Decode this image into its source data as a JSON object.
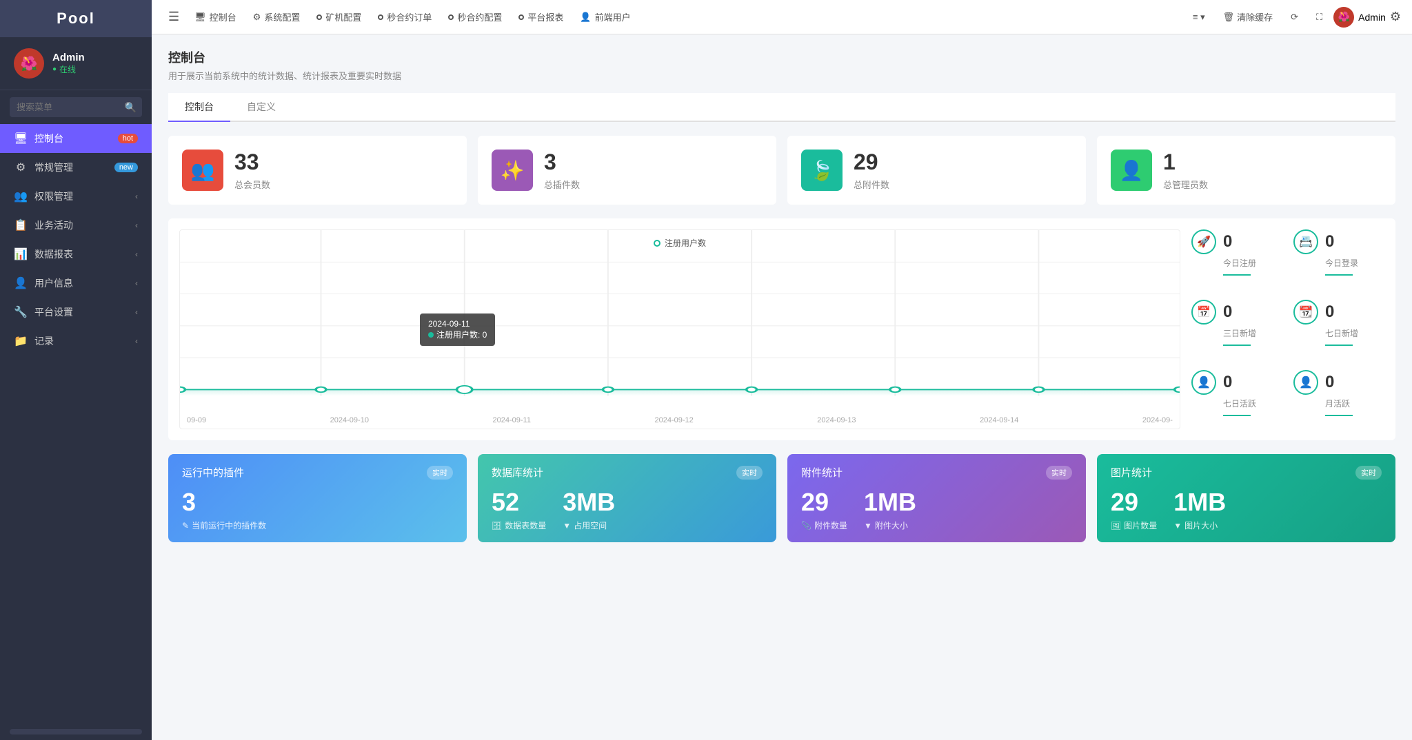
{
  "sidebar": {
    "logo": "Pool",
    "user": {
      "name": "Admin",
      "status": "在线",
      "avatar": "🌺"
    },
    "search_placeholder": "搜索菜单",
    "nav": [
      {
        "id": "dashboard",
        "icon": "🖥",
        "label": "控制台",
        "badge": "hot",
        "badge_type": "hot",
        "active": true
      },
      {
        "id": "general",
        "icon": "⚙",
        "label": "常规管理",
        "badge": "new",
        "badge_type": "new",
        "active": false
      },
      {
        "id": "permission",
        "icon": "👥",
        "label": "权限管理",
        "chevron": true,
        "active": false
      },
      {
        "id": "business",
        "icon": "📋",
        "label": "业务活动",
        "chevron": true,
        "active": false
      },
      {
        "id": "data",
        "icon": "📊",
        "label": "数据报表",
        "chevron": true,
        "active": false
      },
      {
        "id": "userinfo",
        "icon": "👤",
        "label": "用户信息",
        "chevron": true,
        "active": false
      },
      {
        "id": "platform",
        "icon": "🔧",
        "label": "平台设置",
        "chevron": true,
        "active": false
      },
      {
        "id": "record",
        "icon": "📁",
        "label": "记录",
        "chevron": true,
        "active": false
      }
    ]
  },
  "topnav": {
    "items": [
      {
        "icon": "🖥",
        "label": "控制台",
        "dot": false
      },
      {
        "icon": "⚙",
        "label": "系统配置",
        "dot": false
      },
      {
        "icon": "",
        "label": "矿机配置",
        "dot": true
      },
      {
        "icon": "",
        "label": "秒合约订单",
        "dot": true
      },
      {
        "icon": "",
        "label": "秒合约配置",
        "dot": true
      },
      {
        "icon": "",
        "label": "平台报表",
        "dot": true
      },
      {
        "icon": "",
        "label": "前端用户",
        "dot": true
      }
    ],
    "more_label": "≡",
    "clear_label": "清除缓存",
    "admin_label": "Admin",
    "admin_avatar": "🌺"
  },
  "page": {
    "title": "控制台",
    "description": "用于展示当前系统中的统计数据、统计报表及重要实时数据",
    "tabs": [
      {
        "id": "dashboard",
        "label": "控制台",
        "active": true
      },
      {
        "id": "custom",
        "label": "自定义",
        "active": false
      }
    ]
  },
  "stats": [
    {
      "id": "members",
      "icon": "👥",
      "icon_class": "stat-icon-red",
      "num": "33",
      "label": "总会员数"
    },
    {
      "id": "plugins",
      "icon": "✨",
      "icon_class": "stat-icon-purple",
      "num": "3",
      "label": "总插件数"
    },
    {
      "id": "attachments",
      "icon": "🍃",
      "icon_class": "stat-icon-teal",
      "num": "29",
      "label": "总附件数"
    },
    {
      "id": "admins",
      "icon": "👤",
      "icon_class": "stat-icon-green",
      "num": "1",
      "label": "总管理员数"
    }
  ],
  "chart": {
    "title": "注册用户数",
    "tooltip_date": "2024-09-11",
    "tooltip_label": "注册用户数: 0",
    "xaxis": [
      "09-09",
      "2024-09-10",
      "2024-09-11",
      "2024-09-12",
      "2024-09-13",
      "2024-09-14",
      "2024-09-"
    ]
  },
  "side_stats": [
    {
      "id": "today_reg",
      "icon": "🚀",
      "num": "0",
      "label": "今日注册"
    },
    {
      "id": "today_login",
      "icon": "📇",
      "num": "0",
      "label": "今日登录"
    },
    {
      "id": "three_day",
      "icon": "📅",
      "num": "0",
      "label": "三日新增"
    },
    {
      "id": "seven_day_new",
      "icon": "📆",
      "num": "0",
      "label": "七日新增"
    },
    {
      "id": "seven_day_active",
      "icon": "👤",
      "num": "0",
      "label": "七日活跃"
    },
    {
      "id": "month_active",
      "icon": "👤",
      "num": "0",
      "label": "月活跃"
    }
  ],
  "bottom_cards": [
    {
      "id": "plugins_running",
      "title": "运行中的插件",
      "badge": "实时",
      "color_class": "bottom-card-blue",
      "num1": "3",
      "num2": null,
      "label1": "当前运行中的插件数",
      "label1_icon": "✎",
      "label2": null
    },
    {
      "id": "db_stats",
      "title": "数据库统计",
      "badge": "实时",
      "color_class": "bottom-card-teal",
      "num1": "52",
      "num2": "3MB",
      "label1": "数据表数量",
      "label1_icon": "🗄",
      "label2": "占用空间",
      "label2_icon": "▼"
    },
    {
      "id": "attachment_stats",
      "title": "附件统计",
      "badge": "实时",
      "color_class": "bottom-card-purple",
      "num1": "29",
      "num2": "1MB",
      "label1": "附件数量",
      "label1_icon": "📎",
      "label2": "附件大小",
      "label2_icon": "▼"
    },
    {
      "id": "image_stats",
      "title": "图片统计",
      "badge": "实时",
      "color_class": "bottom-card-green",
      "num1": "29",
      "num2": "1MB",
      "label1": "图片数量",
      "label1_icon": "🖼",
      "label2": "图片大小",
      "label2_icon": "▼"
    }
  ]
}
